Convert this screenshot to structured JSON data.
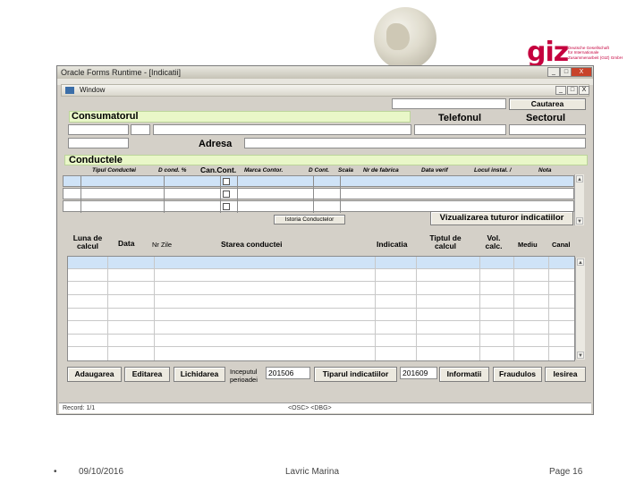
{
  "window": {
    "title": "Oracle Forms Runtime - [Indicatii]",
    "inner_title": "Window",
    "btn_min": "_",
    "btn_max": "□",
    "btn_close": "X"
  },
  "top": {
    "search_button": "Cautarea",
    "consumer_label": "Consumatorul",
    "phone_label": "Telefonul",
    "sector_label": "Sectorul",
    "address_label": "Adresa",
    "pipes_label": "Conductele"
  },
  "pipe_columns": [
    "Tipul Conductei",
    "D cond. %",
    "Can.Cont.",
    "Marca Contor.",
    "D Cont.",
    "Scala",
    "Nr de fabrica",
    "Data verif",
    "Locul instal. /",
    "Nota"
  ],
  "pipe_buttons": {
    "pipe_history": "Istoria Conductelor",
    "view_all": "Vizualizarea tuturor indicatiilor"
  },
  "reading_columns": {
    "month": "Luna de calcul",
    "date": "Data",
    "days": "Nr Zile",
    "state": "Starea conductei",
    "reading": "Indicatia",
    "calc_type": "Tiptul de calcul",
    "vol": "Vol. calc.",
    "avg": "Mediu",
    "channel": "Canal"
  },
  "bottom": {
    "add": "Adaugarea",
    "edit": "Editarea",
    "delete": "Lichidarea",
    "period_label": "Inceputul perioadei",
    "period_start": "201506",
    "print": "Tiparul indicatiilor",
    "print_period": "201609",
    "info": "Informatii",
    "fraud": "Fraudulos",
    "exit": "Iesirea"
  },
  "status": {
    "record": "Record: 1/1",
    "mode": "<OSC> <DBG>"
  },
  "footer": {
    "bullet": "•",
    "date": "09/10/2016",
    "author": "Lavric Marina",
    "page": "Page 16"
  },
  "logo": {
    "mark": "giz",
    "line1": "Deutsche Gesellschaft",
    "line2": "für Internationale",
    "line3": "Zusammenarbeit (GIZ) GmbH"
  },
  "colors": {
    "brand": "#c5003e",
    "selected_row": "#cfe3f7",
    "highlight_bar": "#e9f7c8"
  }
}
